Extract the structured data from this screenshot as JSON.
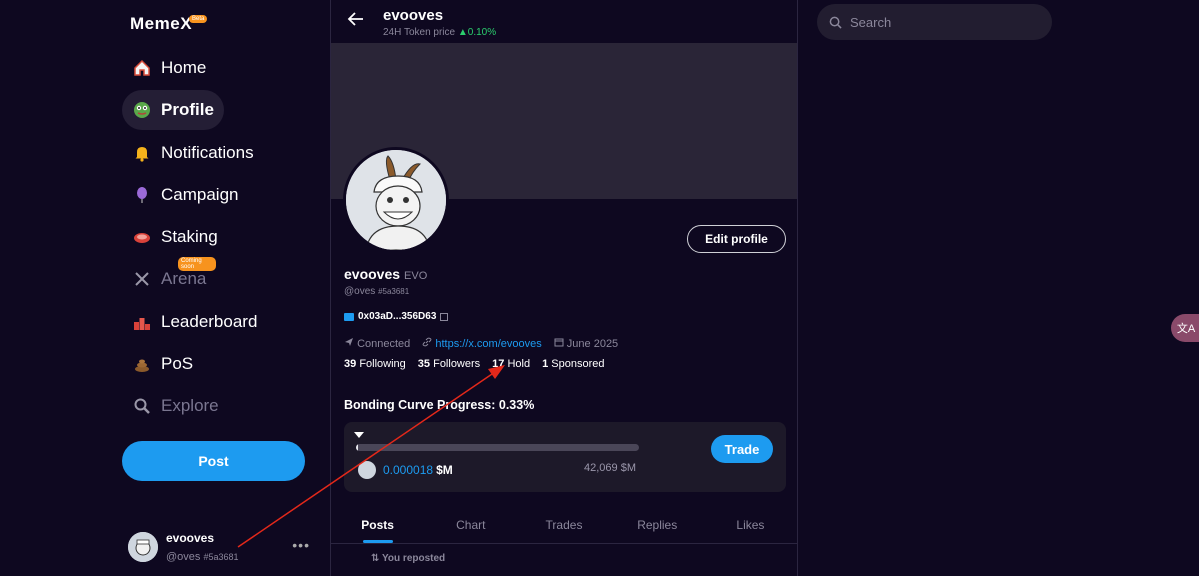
{
  "brand": {
    "logo_text": "Meme",
    "logo_x": "X",
    "badge": "Beta"
  },
  "nav": {
    "items": [
      {
        "label": "Home",
        "icon": "house-icon"
      },
      {
        "label": "Profile",
        "icon": "pepe-icon"
      },
      {
        "label": "Notifications",
        "icon": "bell-icon"
      },
      {
        "label": "Campaign",
        "icon": "balloon-icon"
      },
      {
        "label": "Staking",
        "icon": "steak-icon"
      },
      {
        "label": "Arena",
        "icon": "swords-icon",
        "badge": "Coming soon"
      },
      {
        "label": "Leaderboard",
        "icon": "podium-icon"
      },
      {
        "label": "PoS",
        "icon": "poop-icon"
      },
      {
        "label": "Explore",
        "icon": "magnifier-icon"
      }
    ],
    "post_label": "Post"
  },
  "account": {
    "name": "evooves",
    "handle": "@oves",
    "id": "#5a3681",
    "more": "•••"
  },
  "header": {
    "title": "evooves",
    "subtitle": "24H Token price",
    "change": "▲0.10%"
  },
  "profile": {
    "name": "evooves",
    "ticker": "EVO",
    "handle": "@oves",
    "id": "#5a3681",
    "wallet": "0x03aD...356D63",
    "connected": "Connected",
    "link": "https://x.com/evooves",
    "joined": "June 2025",
    "edit_label": "Edit profile",
    "stats": {
      "following_n": "39",
      "following_l": "Following",
      "followers_n": "35",
      "followers_l": "Followers",
      "hold_n": "17",
      "hold_l": "Hold",
      "sponsored_n": "1",
      "sponsored_l": "Sponsored"
    }
  },
  "bonding": {
    "label": "Bonding Curve Progress: 0.33%",
    "progress": 0.0033,
    "price": "0.000018",
    "unit": "$M",
    "cap": "42,069 $M",
    "trade_label": "Trade"
  },
  "tabs": [
    "Posts",
    "Chart",
    "Trades",
    "Replies",
    "Likes"
  ],
  "feed": {
    "repost": "You reposted"
  },
  "search": {
    "placeholder": "Search"
  },
  "translate": "文A",
  "colors": {
    "accent": "#1d9bf0",
    "bg": "#0e0820",
    "up": "#2bcf6e",
    "annotation": "#e3281a"
  }
}
